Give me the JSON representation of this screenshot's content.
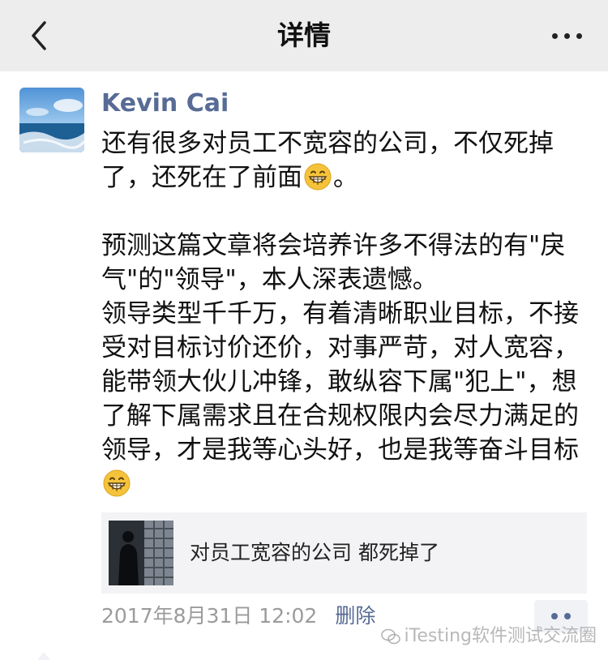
{
  "navbar": {
    "title": "详情",
    "back_icon": "chevron-left-icon",
    "more_icon": "more-dots-icon"
  },
  "post": {
    "author": "Kevin Cai",
    "paragraph1": "还有很多对员工不宽容的公司，不仅死掉了，还死在了前面",
    "paragraph1_tail": "。",
    "paragraph2": "预测这篇文章将会培养许多不得法的有\"戾气\"的\"领导\"，本人深表遗憾。",
    "paragraph3": "领导类型千千万，有着清晰职业目标，不接受对目标讨价还价，对事严苛，对人宽容，能带领大伙儿冲锋，敢纵容下属\"犯上\"，想了解下属需求且在合规权限内会尽力满足的领导，才是我等心头好，也是我等奋斗目标",
    "emoji": "grin-emoji"
  },
  "link_card": {
    "title": "对员工宽容的公司 都死掉了"
  },
  "meta": {
    "timestamp": "2017年8月31日 12:02",
    "delete_label": "删除"
  },
  "watermark": {
    "text": "iTesting软件测试交流圈"
  },
  "colors": {
    "link_blue": "#576b95",
    "navbar_bg": "#ededed",
    "card_bg": "#f3f3f5",
    "meta_gray": "#9b9b9b"
  }
}
